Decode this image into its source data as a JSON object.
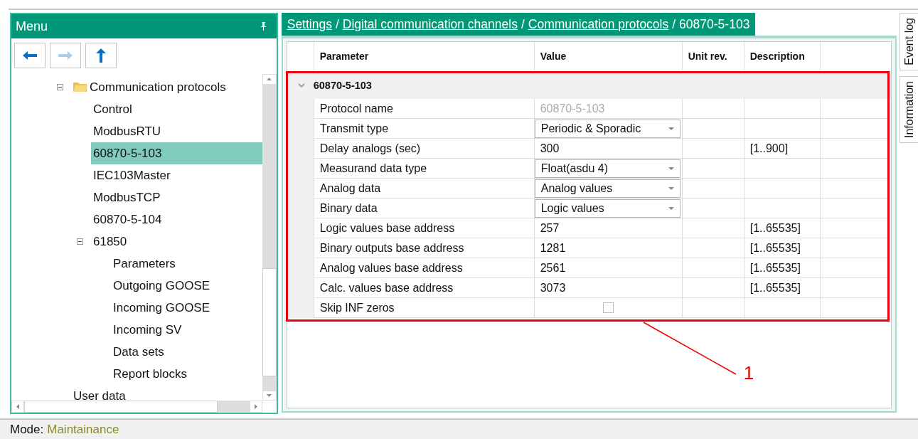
{
  "menu": {
    "title": "Menu",
    "nav_buttons": [
      {
        "kind": "back",
        "disabled": false
      },
      {
        "kind": "forward",
        "disabled": true
      },
      {
        "kind": "up",
        "disabled": false
      }
    ],
    "tree": [
      {
        "label": "Communication protocols",
        "kind": "folder",
        "expanded": true,
        "selected": false,
        "children": [
          {
            "label": "Control",
            "selected": false
          },
          {
            "label": "ModbusRTU",
            "selected": false
          },
          {
            "label": "60870-5-103",
            "selected": true
          },
          {
            "label": "IEC103Master",
            "selected": false
          },
          {
            "label": "ModbusTCP",
            "selected": false
          },
          {
            "label": "60870-5-104",
            "selected": false
          },
          {
            "label": "61850",
            "expanded": true,
            "selected": false,
            "children": [
              {
                "label": "Parameters",
                "selected": false
              },
              {
                "label": "Outgoing GOOSE",
                "selected": false
              },
              {
                "label": "Incoming GOOSE",
                "selected": false
              },
              {
                "label": "Incoming SV",
                "selected": false
              },
              {
                "label": "Data sets",
                "selected": false
              },
              {
                "label": "Report blocks",
                "selected": false
              }
            ]
          }
        ]
      },
      {
        "label": "User data",
        "selected": false
      }
    ]
  },
  "breadcrumb": {
    "separator": "/",
    "items": [
      {
        "label": "Settings",
        "link": true
      },
      {
        "label": "Digital communication channels",
        "link": true
      },
      {
        "label": "Communication protocols",
        "link": true
      },
      {
        "label": "60870-5-103",
        "link": false
      }
    ]
  },
  "table": {
    "columns": [
      "Parameter",
      "Value",
      "Unit rev.",
      "Description"
    ],
    "group": {
      "label": "60870-5-103",
      "expanded": true
    },
    "rows": [
      {
        "parameter": "Protocol name",
        "kind": "readonly",
        "value": "60870-5-103"
      },
      {
        "parameter": "Transmit type",
        "kind": "dropdown",
        "value": "Periodic & Sporadic"
      },
      {
        "parameter": "Delay analogs (sec)",
        "kind": "text",
        "value": "300",
        "description": "[1..900]"
      },
      {
        "parameter": "Measurand data type",
        "kind": "dropdown",
        "value": "Float(asdu 4)"
      },
      {
        "parameter": "Analog data",
        "kind": "dropdown",
        "value": "Analog values"
      },
      {
        "parameter": "Binary data",
        "kind": "dropdown",
        "value": "Logic values"
      },
      {
        "parameter": "Logic values base address",
        "kind": "text",
        "value": "257",
        "description": "[1..65535]"
      },
      {
        "parameter": "Binary outputs base address",
        "kind": "text",
        "value": "1281",
        "description": "[1..65535]"
      },
      {
        "parameter": "Analog values base address",
        "kind": "text",
        "value": "2561",
        "description": "[1..65535]"
      },
      {
        "parameter": "Calc. values base address",
        "kind": "text",
        "value": "3073",
        "description": "[1..65535]"
      },
      {
        "parameter": "Skip INF zeros",
        "kind": "checkbox",
        "checked": false
      }
    ]
  },
  "side_tabs": [
    {
      "label": "Event log"
    },
    {
      "label": "Information"
    }
  ],
  "status_bar": {
    "label": "Mode:",
    "value": "Maintainance"
  },
  "callout": {
    "label": "1"
  }
}
